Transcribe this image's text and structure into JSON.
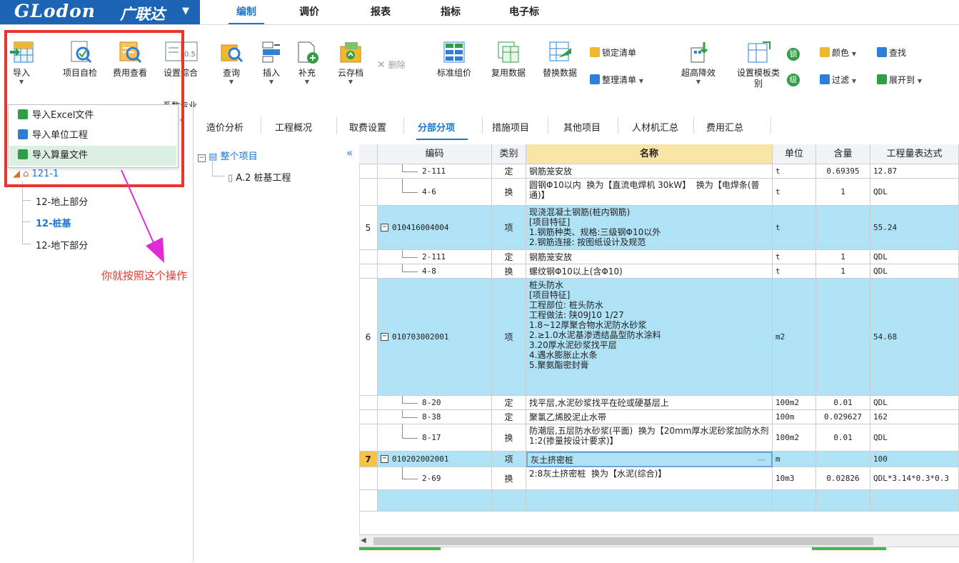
{
  "app": {
    "brand": "GLodon",
    "brand_cn": "广联达"
  },
  "menu": {
    "tabs": [
      "编制",
      "调价",
      "报表",
      "指标",
      "电子标"
    ],
    "active": "编制"
  },
  "ribbon": {
    "import": "导入",
    "self_check": "项目自检",
    "fee_view": "费用查看",
    "settings_part": "设置",
    "comprehensive": "综合",
    "system_major": "系数专业",
    "query": "查询",
    "insert": "插入",
    "supplement": "补充",
    "cloud_save": "云存档",
    "delete": "删除",
    "std_price": "标准组价",
    "reuse_data": "复用数据",
    "replace_data": "替换数据",
    "lock_list": "锁定清单",
    "organize_list": "整理清单",
    "super_reduce": "超高降效",
    "template_cat": "设置模板类别",
    "color": "颜色",
    "find": "查找",
    "filter": "过滤",
    "expand_to": "展开到",
    "mark_a": "锁",
    "mark_b": "级"
  },
  "dropdown": {
    "items": [
      "导入Excel文件",
      "导入单位工程",
      "导入算量文件"
    ]
  },
  "annotation": "你就按照这个操作",
  "left_tree": {
    "root": "121-1",
    "items": [
      "12-地上部分",
      "12-桩基",
      "12-地下部分"
    ]
  },
  "sub_tabs": [
    "造价分析",
    "工程概况",
    "取费设置",
    "分部分项",
    "措施项目",
    "其他项目",
    "人材机汇总",
    "费用汇总"
  ],
  "section_tree": {
    "root": "整个项目",
    "child": "A.2  桩基工程"
  },
  "grid": {
    "headers": {
      "code": "编码",
      "type": "类别",
      "name": "名称",
      "unit": "单位",
      "qty": "含量",
      "expr": "工程量表达式"
    },
    "rows": [
      {
        "no": "",
        "code": "2-111",
        "type": "定",
        "name": "钢筋笼安放",
        "unit": "t",
        "qty": "0.69395",
        "expr": "12.87"
      },
      {
        "no": "",
        "code": "4-6",
        "type": "换",
        "name": "圆钢Φ10以内  换为【直流电焊机 30kW】  换为【电焊条(普通)】",
        "unit": "t",
        "qty": "1",
        "expr": "QDL"
      },
      {
        "no": "5",
        "code": "010416004004",
        "type": "项",
        "name": "现浇混凝土钢筋(桩内钢筋)\n[项目特征]\n1.钢筋种类、规格:三级钢Φ10以外\n2.钢筋连接: 按图纸设计及规范",
        "unit": "t",
        "qty": "",
        "expr": "55.24"
      },
      {
        "no": "",
        "code": "2-111",
        "type": "定",
        "name": "钢筋笼安放",
        "unit": "t",
        "qty": "1",
        "expr": "QDL"
      },
      {
        "no": "",
        "code": "4-8",
        "type": "换",
        "name": "螺纹钢Φ10以上(含Φ10)",
        "unit": "t",
        "qty": "1",
        "expr": "QDL"
      },
      {
        "no": "6",
        "code": "010703002001",
        "type": "项",
        "name": "桩头防水\n[项目特征]\n工程部位: 桩头防水\n工程做法: 陕09J10 1/27\n1.8~12厚聚合物水泥防水砂浆\n2.≥1.0水泥基渗透结晶型防水涂料\n3.20厚水泥砂浆找平层\n4.遇水膨胀止水条\n5.聚氨酯密封膏",
        "unit": "m2",
        "qty": "",
        "expr": "54.68"
      },
      {
        "no": "",
        "code": "8-20",
        "type": "定",
        "name": "找平层,水泥砂浆找平在砼或硬基层上",
        "unit": "100m2",
        "qty": "0.01",
        "expr": "QDL"
      },
      {
        "no": "",
        "code": "8-38",
        "type": "定",
        "name": "聚氯乙烯胶泥止水带",
        "unit": "100m",
        "qty": "0.029627",
        "expr": "162"
      },
      {
        "no": "",
        "code": "8-17",
        "type": "换",
        "name": "防潮层,五层防水砂浆(平面)  换为【20mm厚水泥砂浆加防水剂 1:2(掺量按设计要求)】",
        "unit": "100m2",
        "qty": "0.01",
        "expr": "QDL"
      },
      {
        "no": "7",
        "code": "010202002001",
        "type": "项",
        "name": "灰土挤密桩",
        "unit": "m",
        "qty": "",
        "expr": "100",
        "ellipsis": "···"
      },
      {
        "no": "",
        "code": "2-69",
        "type": "换",
        "name": "2:8灰土挤密桩  换为【水泥(综合)】",
        "unit": "10m3",
        "qty": "0.02826",
        "expr": "QDL*3.14*0.3*0.3"
      }
    ]
  },
  "colors": {
    "accent": "#1976d2",
    "logo_bg": "#1e64b4",
    "highlight_row": "#b0e2f6",
    "name_header": "#f9e5a6",
    "red": "#e8352d",
    "arrow": "#e02bd6"
  }
}
